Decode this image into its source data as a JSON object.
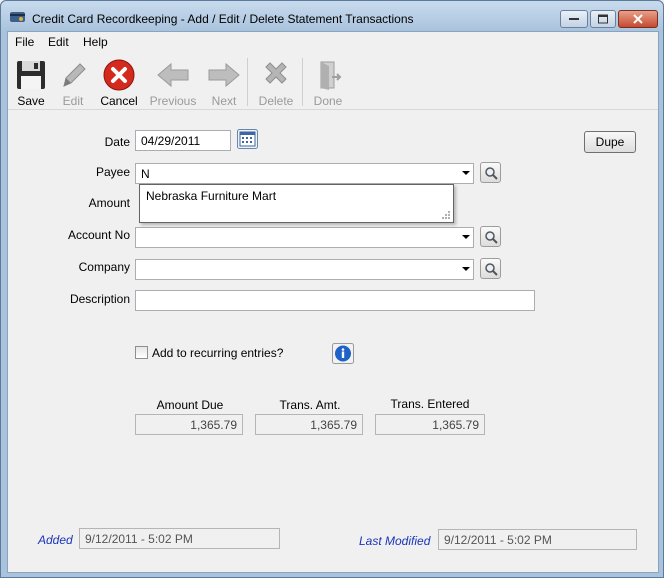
{
  "window": {
    "title": "Credit Card Recordkeeping - Add / Edit / Delete Statement Transactions"
  },
  "menu": {
    "file": "File",
    "edit": "Edit",
    "help": "Help"
  },
  "toolbar": {
    "save": "Save",
    "edit": "Edit",
    "cancel": "Cancel",
    "previous": "Previous",
    "next": "Next",
    "delete": "Delete",
    "done": "Done"
  },
  "form": {
    "date_label": "Date",
    "date_value": "04/29/2011",
    "dupe_label": "Dupe",
    "payee_label": "Payee",
    "payee_value": "N",
    "payee_suggestion": "Nebraska Furniture Mart",
    "amount_label": "Amount",
    "account_label": "Account No",
    "account_value": "",
    "company_label": "Company",
    "company_value": "",
    "description_label": "Description",
    "description_value": "",
    "recurring_label": "Add to recurring entries?"
  },
  "totals": {
    "amount_due_label": "Amount Due",
    "amount_due_value": "1,365.79",
    "trans_amt_label": "Trans. Amt.",
    "trans_amt_value": "1,365.79",
    "trans_entered_label": "Trans. Entered",
    "trans_entered_value": "1,365.79"
  },
  "footer": {
    "added_label": "Added",
    "added_value": "9/12/2011 - 5:02 PM",
    "modified_label": "Last Modified",
    "modified_value": "9/12/2011 - 5:02 PM"
  },
  "colors": {
    "cancel_red": "#d42a1e",
    "info_blue": "#1e62c8",
    "italic_blue": "#1a35b8"
  }
}
